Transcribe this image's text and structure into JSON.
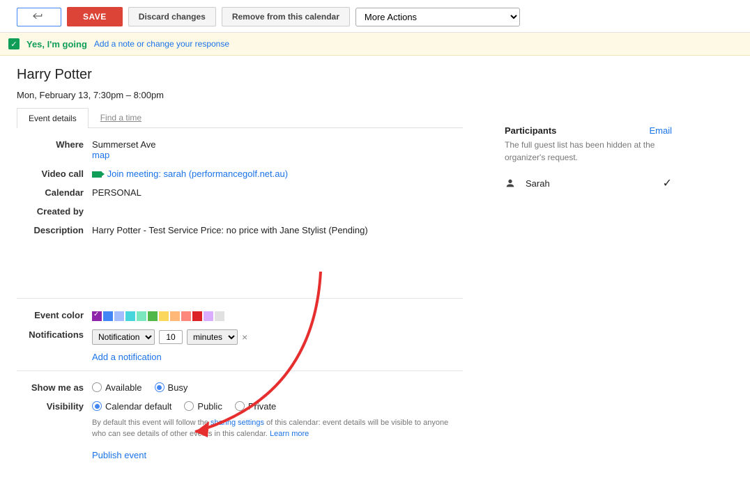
{
  "toolbar": {
    "save": "SAVE",
    "discard": "Discard changes",
    "remove": "Remove from this calendar",
    "moreActions": "More Actions"
  },
  "rsvp": {
    "status": "Yes, I'm going",
    "note": "Add a note or change your response"
  },
  "event": {
    "title": "Harry Potter",
    "datetime": "Mon, February 13, 7:30pm – 8:00pm"
  },
  "tabs": {
    "details": "Event details",
    "findTime": "Find a time"
  },
  "labels": {
    "where": "Where",
    "videoCall": "Video call",
    "calendar": "Calendar",
    "createdBy": "Created by",
    "description": "Description",
    "eventColor": "Event color",
    "notifications": "Notifications",
    "showMeAs": "Show me as",
    "visibility": "Visibility"
  },
  "where": {
    "address": "Summerset Ave",
    "mapLink": "map"
  },
  "videoCall": {
    "text": "Join meeting: sarah (performancegolf.net.au)"
  },
  "calendar": "PERSONAL",
  "createdBy": "",
  "description": "Harry Potter - Test Service Price: no price with Jane Stylist (Pending)",
  "colors": [
    "#8e24aa",
    "#4285f4",
    "#a4bdfc",
    "#46d6db",
    "#7ae7bf",
    "#51b749",
    "#fbd75b",
    "#ffb878",
    "#ff887c",
    "#dc2127",
    "#dbadff",
    "#e1e1e1"
  ],
  "notification": {
    "type": "Notification",
    "amount": "10",
    "unit": "minutes",
    "add": "Add a notification"
  },
  "showMeAs": {
    "available": "Available",
    "busy": "Busy"
  },
  "visibility": {
    "default": "Calendar default",
    "public": "Public",
    "private": "Private",
    "note1": "By default this event will follow the ",
    "noteLink1": "sharing settings",
    "note2": " of this calendar: event details will be visible to anyone who can see details of other events in this calendar.  ",
    "noteLink2": "Learn more",
    "publish": "Publish event"
  },
  "participants": {
    "title": "Participants",
    "emailLink": "Email",
    "hidden": "The full guest list has been hidden at the organizer's request.",
    "guest": "Sarah"
  }
}
